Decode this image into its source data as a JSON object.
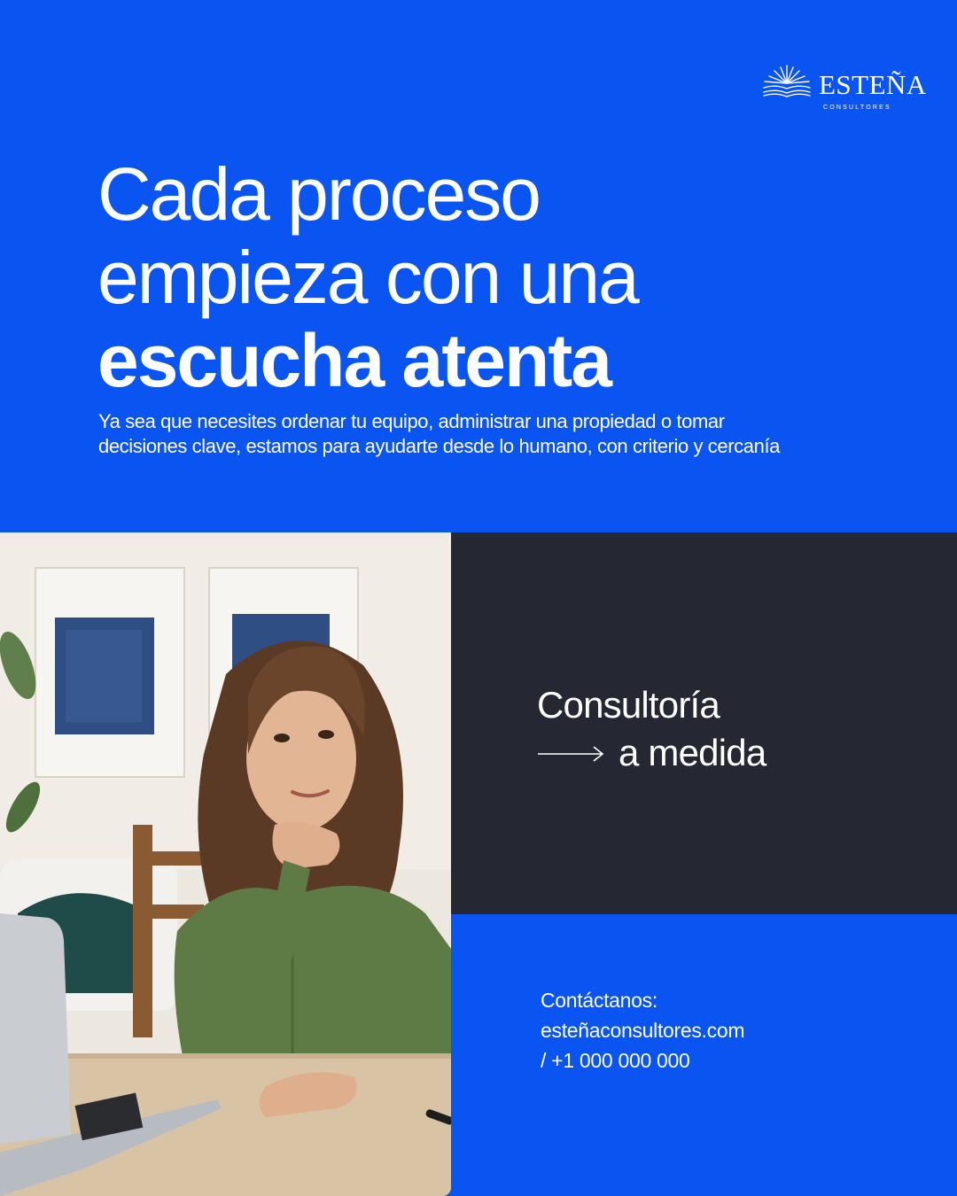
{
  "brand": {
    "name": "ESTEÑA",
    "tagline": "CONSULTORES",
    "logo_icon": "sunburst-book-icon"
  },
  "headline": {
    "line1": "Cada proceso",
    "line2": "empieza con una",
    "line3": "escucha atenta"
  },
  "lead": {
    "line1": "Ya sea que necesites ordenar tu equipo, administrar una propiedad o tomar",
    "line2": "decisiones clave, estamos para ayudarte desde lo humano, con criterio y cercanía"
  },
  "service": {
    "line1": "Consultoría",
    "line2": "a medida",
    "arrow_icon": "long-arrow-right-icon"
  },
  "contact": {
    "label": "Contáctanos:",
    "website": "esteñaconsultores.com",
    "phone": "/ +1 000 000 000"
  },
  "photo": {
    "subject": "woman-at-laptop-photo"
  },
  "colors": {
    "primary_blue": "#0a55f2",
    "dark_panel": "#252833",
    "text": "#ffffff"
  }
}
